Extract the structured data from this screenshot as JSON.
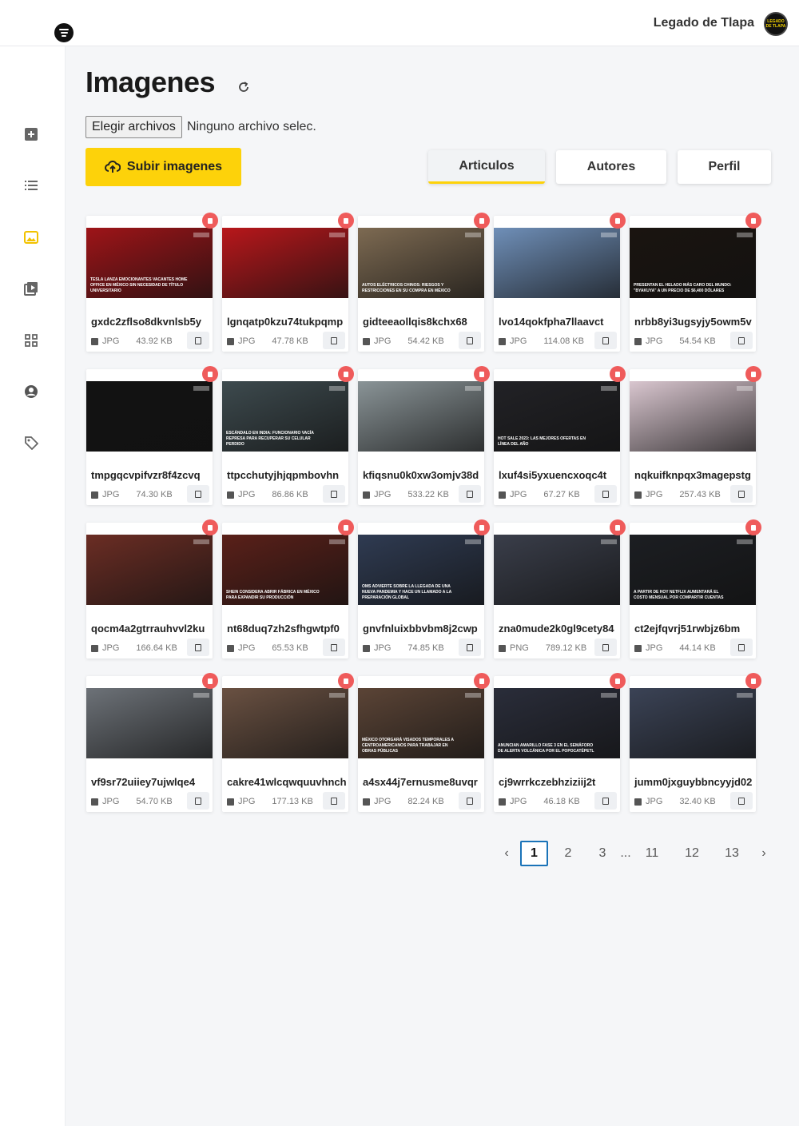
{
  "header": {
    "site_name": "Legado de Tlapa",
    "avatar_text": "LEGADO DE TLAPA"
  },
  "page": {
    "title": "Imagenes"
  },
  "file_input": {
    "button_label": "Elegir archivos",
    "status": "Ninguno archivo selec."
  },
  "upload_button": {
    "label": "Subir imagenes"
  },
  "tabs": [
    {
      "label": "Articulos",
      "active": true
    },
    {
      "label": "Autores",
      "active": false
    },
    {
      "label": "Perfil",
      "active": false
    }
  ],
  "sidebar": {
    "items": [
      {
        "icon": "add-square-icon"
      },
      {
        "icon": "list-icon"
      },
      {
        "icon": "image-icon",
        "active": true
      },
      {
        "icon": "video-icon"
      },
      {
        "icon": "grid-icon"
      },
      {
        "icon": "user-icon"
      },
      {
        "icon": "tag-icon"
      }
    ]
  },
  "images": [
    {
      "name": "gxdc2zflso8dkvnlsb5y",
      "type": "JPG",
      "size": "43.92 KB",
      "caption": "TESLA LANZA EMOCIONANTES VACANTES HOME OFFICE EN MÉXICO SIN NECESIDAD DE TÍTULO UNIVERSITARIO",
      "bg": "#9e1418"
    },
    {
      "name": "lgnqatp0kzu74tukpqmp",
      "type": "JPG",
      "size": "47.78 KB",
      "caption": "",
      "bg": "#b8171b"
    },
    {
      "name": "gidteeaollqis8kchx68",
      "type": "JPG",
      "size": "54.42 KB",
      "caption": "AUTOS ELÉCTRICOS CHINOS: RIESGOS Y RESTRICCIONES EN SU COMPRA EN MÉXICO",
      "bg": "#7d6a52"
    },
    {
      "name": "lvo14qokfpha7llaavct",
      "type": "JPG",
      "size": "114.08 KB",
      "caption": "",
      "bg": "#6f8fb8"
    },
    {
      "name": "nrbb8yi3ugsyjy5owm5v",
      "type": "JPG",
      "size": "54.54 KB",
      "caption": "PRESENTAN EL HELADO MÁS CARO DEL MUNDO: \"BYAKUYA\" A UN PRECIO DE $6,400 DÓLARES",
      "bg": "#1a1410"
    },
    {
      "name": "tmpgqcvpifvzr8f4zcvq",
      "type": "JPG",
      "size": "74.30 KB",
      "caption": "",
      "bg": "#121212"
    },
    {
      "name": "ttpcchutyjhjqpmbovhn",
      "type": "JPG",
      "size": "86.86 KB",
      "caption": "ESCÁNDALO EN INDIA: FUNCIONARIO VACÍA REPRESA PARA RECUPERAR SU CELULAR PERDIDO",
      "bg": "#3d4a4e"
    },
    {
      "name": "kfiqsnu0k0xw3omjv38d",
      "type": "JPG",
      "size": "533.22 KB",
      "caption": "",
      "bg": "#8a9497"
    },
    {
      "name": "lxuf4si5yxuencxoqc4t",
      "type": "JPG",
      "size": "67.27 KB",
      "caption": "HOT SALE 2023: LAS MEJORES OFERTAS EN LÍNEA DEL AÑO",
      "bg": "#222226"
    },
    {
      "name": "nqkuifknpqx3magepstg",
      "type": "JPG",
      "size": "257.43 KB",
      "caption": "",
      "bg": "#d9c6cf"
    },
    {
      "name": "qocm4a2gtrrauhvvl2ku",
      "type": "JPG",
      "size": "166.64 KB",
      "caption": "",
      "bg": "#6b2d24"
    },
    {
      "name": "nt68duq7zh2sfhgwtpf0",
      "type": "JPG",
      "size": "65.53 KB",
      "caption": "SHEIN CONSIDERA ABRIR FÁBRICA EN MÉXICO PARA EXPANDIR SU PRODUCCIÓN",
      "bg": "#5a2019"
    },
    {
      "name": "gnvfnluixbbvbm8j2cwp",
      "type": "JPG",
      "size": "74.85 KB",
      "caption": "OMS ADVIERTE SOBRE LA LLEGADA DE UNA NUEVA PANDEMIA Y HACE UN LLAMADO A LA PREPARACIÓN GLOBAL",
      "bg": "#2f3b52"
    },
    {
      "name": "zna0mude2k0gl9cety84",
      "type": "PNG",
      "size": "789.12 KB",
      "caption": "",
      "bg": "#3a3e4a"
    },
    {
      "name": "ct2ejfqvrj51rwbjz6bm",
      "type": "JPG",
      "size": "44.14 KB",
      "caption": "A PARTIR DE HOY NETFLIX AUMENTARÁ EL COSTO MENSUAL POR COMPARTIR CUENTAS",
      "bg": "#1c1e22"
    },
    {
      "name": "vf9sr72uiiey7ujwlqe4",
      "type": "JPG",
      "size": "54.70 KB",
      "caption": "",
      "bg": "#6d7278"
    },
    {
      "name": "cakre41wlcqwquuvhnch",
      "type": "JPG",
      "size": "177.13 KB",
      "caption": "",
      "bg": "#6a5142"
    },
    {
      "name": "a4sx44j7ernusme8uvqr",
      "type": "JPG",
      "size": "82.24 KB",
      "caption": "MÉXICO OTORGARÁ VISADOS TEMPORALES A CENTROAMERICANOS PARA TRABAJAR EN OBRAS PÚBLICAS",
      "bg": "#5b4436"
    },
    {
      "name": "cj9wrrkczebhziziij2t",
      "type": "JPG",
      "size": "46.18 KB",
      "caption": "ANUNCIAN AMARILLO FASE 3 EN EL SEMÁFORO DE ALERTA VOLCÁNICA POR EL POPOCATÉPETL",
      "bg": "#2a2d3a"
    },
    {
      "name": "jumm0jxguybbncyyjd02",
      "type": "JPG",
      "size": "32.40 KB",
      "caption": "",
      "bg": "#3b4356"
    }
  ],
  "pagination": {
    "prev": "‹",
    "next": "›",
    "pages": [
      "1",
      "2",
      "3",
      "...",
      "11",
      "12",
      "13"
    ],
    "current": "1"
  },
  "colors": {
    "accent": "#fdd20a",
    "delete": "#ef5b5b",
    "pager_active": "#1a73b8"
  }
}
